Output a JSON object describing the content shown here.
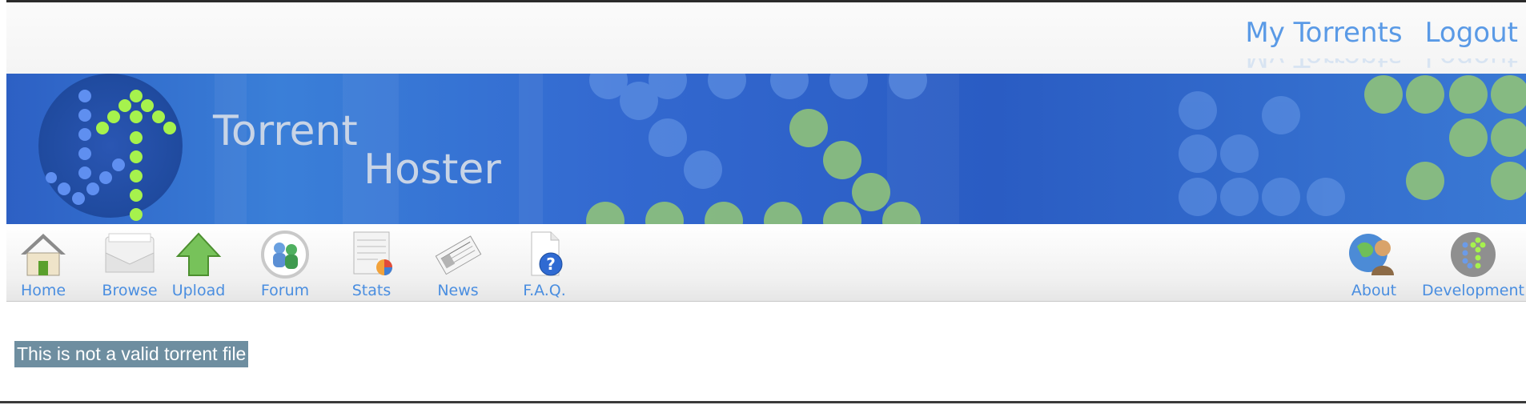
{
  "toplinks": {
    "my_torrents": "My Torrents",
    "logout": "Logout"
  },
  "banner": {
    "title_line1": "Torrent",
    "title_line2": "Hoster"
  },
  "nav": {
    "left": [
      {
        "label": "Home",
        "icon": "home-icon"
      },
      {
        "label": "Browse",
        "icon": "browse-icon"
      },
      {
        "label": "Upload",
        "icon": "upload-icon"
      },
      {
        "label": "Forum",
        "icon": "forum-icon"
      },
      {
        "label": "Stats",
        "icon": "stats-icon"
      },
      {
        "label": "News",
        "icon": "news-icon"
      },
      {
        "label": "F.A.Q.",
        "icon": "faq-icon"
      }
    ],
    "right": [
      {
        "label": "About",
        "icon": "about-icon"
      },
      {
        "label": "Development",
        "icon": "development-icon"
      }
    ]
  },
  "message": {
    "text": "This is not a valid torrent file"
  },
  "colors": {
    "link": "#5a9ae6",
    "banner": "#3369d0",
    "dot_green": "#9ff24a",
    "message_bg": "#6e8ea0"
  }
}
